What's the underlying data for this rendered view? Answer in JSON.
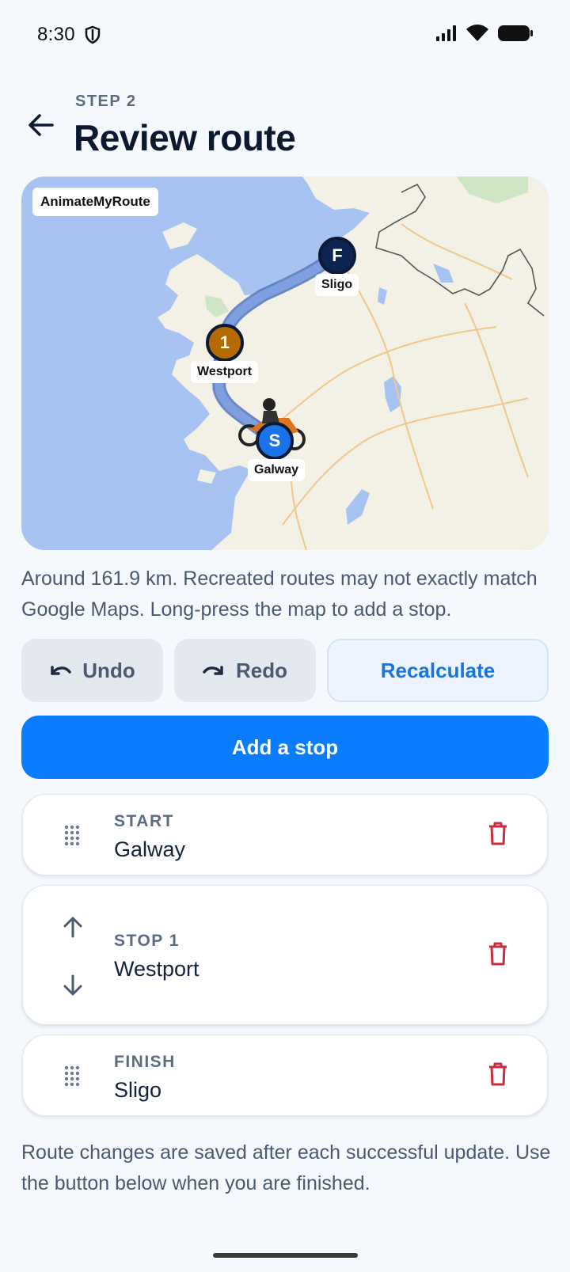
{
  "status": {
    "time": "8:30"
  },
  "header": {
    "step": "STEP 2",
    "title": "Review route"
  },
  "map": {
    "brand": "AnimateMyRoute",
    "markers": [
      {
        "letter": "F",
        "label": "Sligo",
        "color": "#0c2450"
      },
      {
        "letter": "1",
        "label": "Westport",
        "color": "#b36b00"
      },
      {
        "letter": "S",
        "label": "Galway",
        "color": "#1a73e8"
      }
    ]
  },
  "note": "Around 161.9 km. Recreated routes may not exactly match Google Maps. Long-press the map to add a stop.",
  "actions": {
    "undo": "Undo",
    "redo": "Redo",
    "recalculate": "Recalculate",
    "add_stop": "Add a stop"
  },
  "stops": [
    {
      "kind": "START",
      "name": "Galway"
    },
    {
      "kind": "STOP 1",
      "name": "Westport"
    },
    {
      "kind": "FINISH",
      "name": "Sligo"
    }
  ],
  "footer": "Route changes are saved after each successful update. Use the button below when you are finished.",
  "colors": {
    "primary": "#0a7dff",
    "delete": "#c62f3e",
    "route": "#6b8fd0"
  }
}
